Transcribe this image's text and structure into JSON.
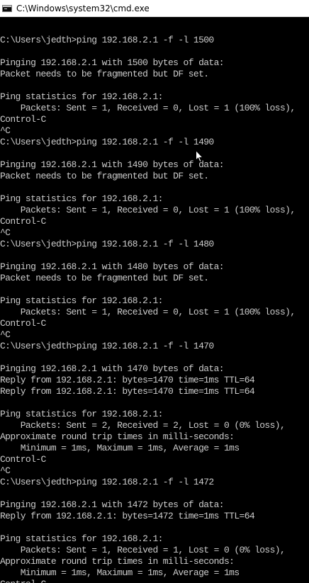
{
  "window": {
    "title": "C:\\Windows\\system32\\cmd.exe",
    "icon": "console-icon"
  },
  "console": {
    "background": "#000000",
    "foreground": "#cccccc",
    "lines": [
      "",
      "C:\\Users\\jedth>ping 192.168.2.1 -f -l 1500",
      "",
      "Pinging 192.168.2.1 with 1500 bytes of data:",
      "Packet needs to be fragmented but DF set.",
      "",
      "Ping statistics for 192.168.2.1:",
      "    Packets: Sent = 1, Received = 0, Lost = 1 (100% loss),",
      "Control-C",
      "^C",
      "C:\\Users\\jedth>ping 192.168.2.1 -f -l 1490",
      "",
      "Pinging 192.168.2.1 with 1490 bytes of data:",
      "Packet needs to be fragmented but DF set.",
      "",
      "Ping statistics for 192.168.2.1:",
      "    Packets: Sent = 1, Received = 0, Lost = 1 (100% loss),",
      "Control-C",
      "^C",
      "C:\\Users\\jedth>ping 192.168.2.1 -f -l 1480",
      "",
      "Pinging 192.168.2.1 with 1480 bytes of data:",
      "Packet needs to be fragmented but DF set.",
      "",
      "Ping statistics for 192.168.2.1:",
      "    Packets: Sent = 1, Received = 0, Lost = 1 (100% loss),",
      "Control-C",
      "^C",
      "C:\\Users\\jedth>ping 192.168.2.1 -f -l 1470",
      "",
      "Pinging 192.168.2.1 with 1470 bytes of data:",
      "Reply from 192.168.2.1: bytes=1470 time=1ms TTL=64",
      "Reply from 192.168.2.1: bytes=1470 time=1ms TTL=64",
      "",
      "Ping statistics for 192.168.2.1:",
      "    Packets: Sent = 2, Received = 2, Lost = 0 (0% loss),",
      "Approximate round trip times in milli-seconds:",
      "    Minimum = 1ms, Maximum = 1ms, Average = 1ms",
      "Control-C",
      "^C",
      "C:\\Users\\jedth>ping 192.168.2.1 -f -l 1472",
      "",
      "Pinging 192.168.2.1 with 1472 bytes of data:",
      "Reply from 192.168.2.1: bytes=1472 time=1ms TTL=64",
      "",
      "Ping statistics for 192.168.2.1:",
      "    Packets: Sent = 1, Received = 1, Lost = 0 (0% loss),",
      "Approximate round trip times in milli-seconds:",
      "    Minimum = 1ms, Maximum = 1ms, Average = 1ms",
      "Control-C"
    ]
  },
  "mouse_cursor": {
    "icon": "mouse-pointer-icon"
  }
}
